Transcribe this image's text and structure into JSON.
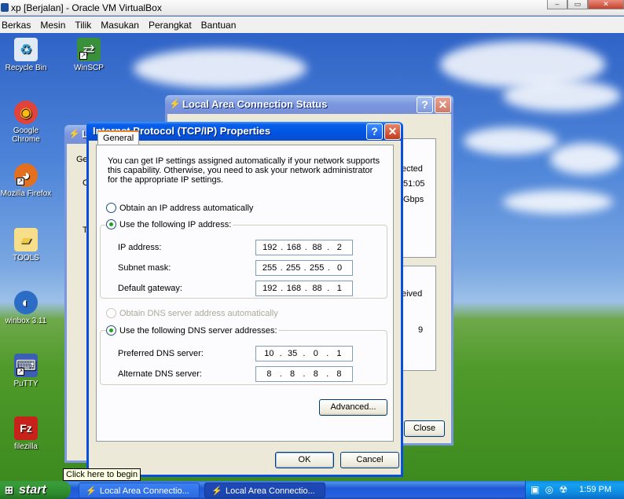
{
  "host": {
    "title": "xp [Berjalan] - Oracle VM VirtualBox",
    "window_controls": [
      "–",
      "▭",
      "✕"
    ],
    "menu": [
      "Berkas",
      "Mesin",
      "Tilik",
      "Masukan",
      "Perangkat",
      "Bantuan"
    ]
  },
  "desktop_icons": [
    {
      "name": "recycle-bin",
      "label": "Recycle Bin",
      "glyph": "♻",
      "color": "#2d9bd6"
    },
    {
      "name": "winscp",
      "label": "WinSCP",
      "glyph": "⇄",
      "color": "#3a8f3a"
    },
    {
      "name": "google-chrome",
      "label": "Google Chrome",
      "glyph": "◉",
      "color": "#e0433a"
    },
    {
      "name": "mozilla-firefox",
      "label": "Mozilla Firefox",
      "glyph": "◕",
      "color": "#e2701f"
    },
    {
      "name": "tools",
      "label": "TOOLS",
      "glyph": "▰",
      "color": "#f0c94a"
    },
    {
      "name": "winbox",
      "label": "winbox 3.11",
      "glyph": "◐",
      "color": "#2b6cc4"
    },
    {
      "name": "putty",
      "label": "PuTTY",
      "glyph": "⌨",
      "color": "#3b5fb4"
    },
    {
      "name": "filezilla",
      "label": "filezilla",
      "glyph": "Fz",
      "color": "#c8231a"
    }
  ],
  "status_window": {
    "title": "Local Area Connection Status",
    "help": "?",
    "close": "✕",
    "partial_texts": [
      "ected",
      "51:05",
      "Gbps",
      "eived",
      "9"
    ],
    "close_button": "Close"
  },
  "back_window": {
    "title_fragment": "L",
    "tab_fragment": "Ge",
    "letters": [
      "C",
      "T"
    ]
  },
  "tcpip": {
    "title": "Internet Protocol (TCP/IP) Properties",
    "help": "?",
    "close": "✕",
    "tab": "General",
    "description": "You can get IP settings assigned automatically if your network supports this capability. Otherwise, you need to ask your network administrator for the appropriate IP settings.",
    "ip_auto": "Obtain an IP address automatically",
    "ip_manual": "Use the following IP address:",
    "ip_label": "IP address:",
    "ip_value": [
      "192",
      "168",
      "88",
      "2"
    ],
    "subnet_label": "Subnet mask:",
    "subnet_value": [
      "255",
      "255",
      "255",
      "0"
    ],
    "gateway_label": "Default gateway:",
    "gateway_value": [
      "192",
      "168",
      "88",
      "1"
    ],
    "dns_auto": "Obtain DNS server address automatically",
    "dns_manual": "Use the following DNS server addresses:",
    "pref_dns_label": "Preferred DNS server:",
    "pref_dns_value": [
      "10",
      "35",
      "0",
      "1"
    ],
    "alt_dns_label": "Alternate DNS server:",
    "alt_dns_value": [
      "8",
      "8",
      "8",
      "8"
    ],
    "advanced": "Advanced...",
    "ok": "OK",
    "cancel": "Cancel"
  },
  "taskbar": {
    "start": "start",
    "tooltip": "Click here to begin",
    "tasks": [
      "Local Area Connectio...",
      "Local Area Connectio..."
    ],
    "clock": "1:59 PM"
  }
}
